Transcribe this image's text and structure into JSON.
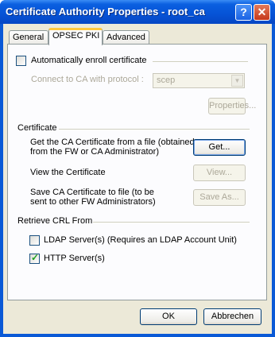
{
  "window": {
    "title": "Certificate Authority Properties - root_ca",
    "help_glyph": "?",
    "close_glyph": "✕"
  },
  "tabs": [
    {
      "label": "General"
    },
    {
      "label": "OPSEC PKI"
    },
    {
      "label": "Advanced"
    }
  ],
  "enroll": {
    "auto_label": "Automatically enroll certificate",
    "auto_checked": false,
    "protocol_label": "Connect to CA with protocol :",
    "protocol_value": "scep",
    "properties_label": "Properties..."
  },
  "certificate": {
    "group_label": "Certificate",
    "get_line1": "Get the CA Certificate from a file (obtained",
    "get_line2": "from the FW or CA Administrator)",
    "get_button": "Get...",
    "view_label": "View the Certificate",
    "view_button": "View...",
    "save_line1": "Save CA Certificate to file (to be",
    "save_line2": "sent to other FW Administrators)",
    "save_button": "Save As..."
  },
  "crl": {
    "group_label": "Retrieve CRL From",
    "ldap_label": "LDAP Server(s) (Requires an LDAP Account Unit)",
    "ldap_checked": false,
    "http_label": "HTTP Server(s)",
    "http_checked": true
  },
  "footer": {
    "ok_label": "OK",
    "cancel_label": "Abbrechen"
  }
}
